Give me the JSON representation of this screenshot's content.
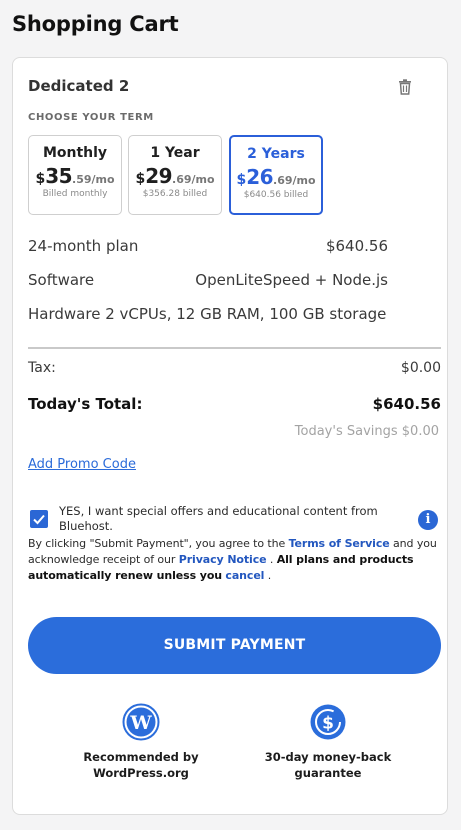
{
  "page": {
    "title": "Shopping Cart"
  },
  "cart": {
    "plan_name": "Dedicated 2",
    "term_label": "CHOOSE YOUR TERM",
    "terms": [
      {
        "name": "Monthly",
        "dollar": "$",
        "price_big": "35",
        "price_small": ".59/mo",
        "billed": "Billed monthly",
        "selected": false
      },
      {
        "name": "1 Year",
        "dollar": "$",
        "price_big": "29",
        "price_small": ".69/mo",
        "billed": "$356.28 billed",
        "selected": false
      },
      {
        "name": "2 Years",
        "dollar": "$",
        "price_big": "26",
        "price_small": ".69/mo",
        "billed": "$640.56 billed",
        "selected": true
      }
    ],
    "details": {
      "plan_label": "24-month plan",
      "plan_value": "$640.56",
      "software_label": "Software",
      "software_value": "OpenLiteSpeed + Node.js",
      "hardware_label": "Hardware",
      "hardware_value": "2 vCPUs, 12 GB RAM, 100 GB storage"
    },
    "tax_label": "Tax:",
    "tax_value": "$0.00",
    "total_label": "Today's Total:",
    "total_value": "$640.56",
    "savings": "Today's Savings $0.00",
    "promo_link": "Add Promo Code",
    "optin_text": "YES, I want special offers and educational content from Bluehost.",
    "optin_checked": true,
    "info_icon": "i",
    "legal": {
      "part1": "By clicking \"Submit Payment\", you agree to the ",
      "tos_link": "Terms of Service",
      "part2": " and you acknowledge receipt of our ",
      "privacy_link": "Privacy Notice",
      "part3": " . ",
      "bold_text": "All plans and products automatically renew unless you",
      "cancel_link": "cancel",
      "part4": " ."
    },
    "submit_label": "SUBMIT PAYMENT",
    "badges": [
      {
        "icon": "wordpress-icon",
        "text_line1": "Recommended by",
        "text_line2": "WordPress.org"
      },
      {
        "icon": "money-back-icon",
        "text_line1": "30-day money-back",
        "text_line2": "guarantee"
      }
    ]
  },
  "colors": {
    "accent": "#2b6ddb",
    "selected_border": "#2b5fd9"
  }
}
